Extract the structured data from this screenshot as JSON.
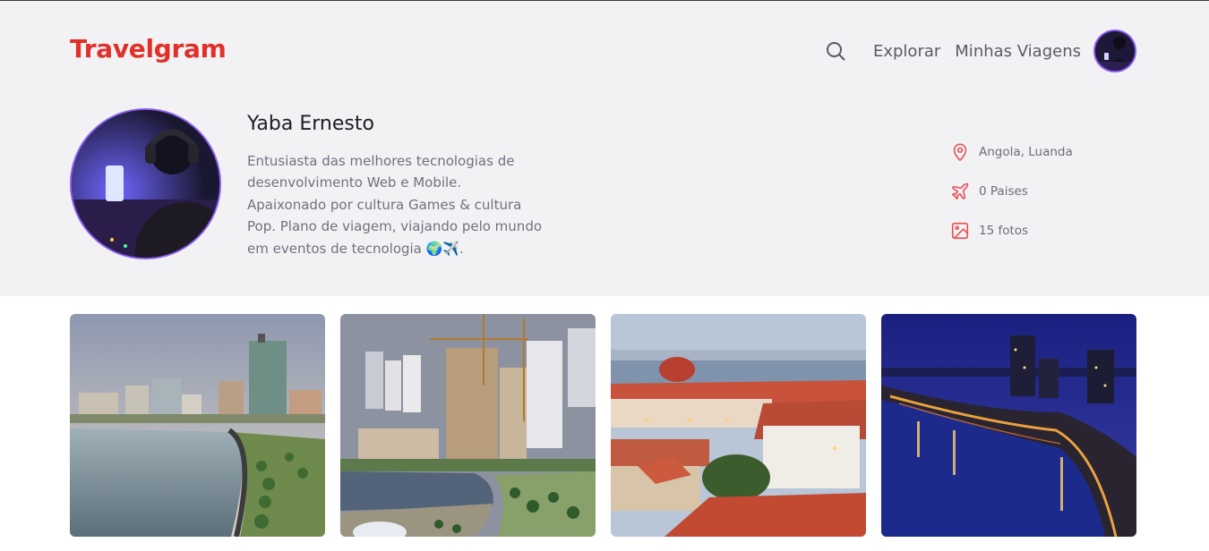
{
  "header": {
    "logo": "Travelgram",
    "nav": {
      "search_icon": "search-icon",
      "links": [
        "Explorar",
        "Minhas Viagens"
      ]
    }
  },
  "profile": {
    "name": "Yaba Ernesto",
    "bio": "Entusiasta das melhores tecnologias de desenvolvimento Web e Mobile. Apaixonado por cultura Games & cultura Pop. Plano de viagem, viajando pelo mundo em eventos de tecnologia 🌍✈️.",
    "stats": [
      {
        "icon": "map-pin-icon",
        "label": "Angola, Luanda"
      },
      {
        "icon": "airplane-icon",
        "label": "0 Paises"
      },
      {
        "icon": "image-icon",
        "label": "15 fotos"
      }
    ]
  },
  "colors": {
    "brand": "#e0302a",
    "accent_border": "#8a5cf0",
    "band_background": "#f2f2f4"
  },
  "gallery": {
    "photos": [
      "luanda-bay-photo",
      "luanda-construction-photo",
      "luanda-red-roofs-photo",
      "luanda-night-photo"
    ]
  }
}
